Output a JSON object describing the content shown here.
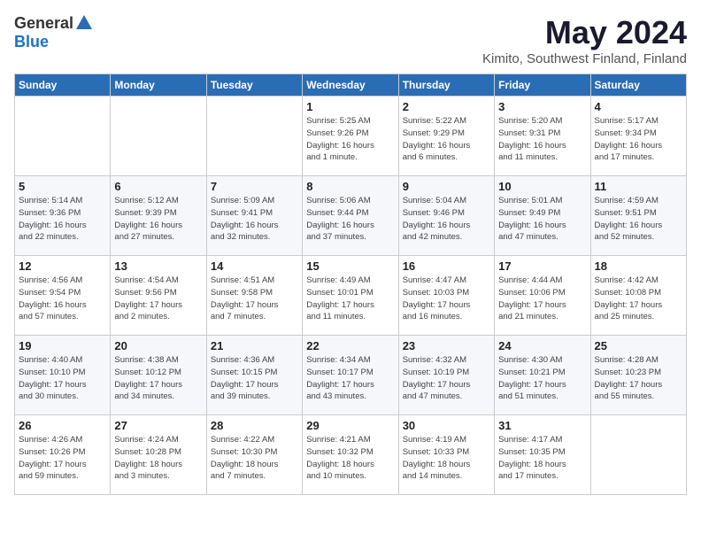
{
  "logo": {
    "general": "General",
    "blue": "Blue"
  },
  "header": {
    "month": "May 2024",
    "location": "Kimito, Southwest Finland, Finland"
  },
  "weekdays": [
    "Sunday",
    "Monday",
    "Tuesday",
    "Wednesday",
    "Thursday",
    "Friday",
    "Saturday"
  ],
  "weeks": [
    [
      {
        "day": "",
        "info": ""
      },
      {
        "day": "",
        "info": ""
      },
      {
        "day": "",
        "info": ""
      },
      {
        "day": "1",
        "info": "Sunrise: 5:25 AM\nSunset: 9:26 PM\nDaylight: 16 hours\nand 1 minute."
      },
      {
        "day": "2",
        "info": "Sunrise: 5:22 AM\nSunset: 9:29 PM\nDaylight: 16 hours\nand 6 minutes."
      },
      {
        "day": "3",
        "info": "Sunrise: 5:20 AM\nSunset: 9:31 PM\nDaylight: 16 hours\nand 11 minutes."
      },
      {
        "day": "4",
        "info": "Sunrise: 5:17 AM\nSunset: 9:34 PM\nDaylight: 16 hours\nand 17 minutes."
      }
    ],
    [
      {
        "day": "5",
        "info": "Sunrise: 5:14 AM\nSunset: 9:36 PM\nDaylight: 16 hours\nand 22 minutes."
      },
      {
        "day": "6",
        "info": "Sunrise: 5:12 AM\nSunset: 9:39 PM\nDaylight: 16 hours\nand 27 minutes."
      },
      {
        "day": "7",
        "info": "Sunrise: 5:09 AM\nSunset: 9:41 PM\nDaylight: 16 hours\nand 32 minutes."
      },
      {
        "day": "8",
        "info": "Sunrise: 5:06 AM\nSunset: 9:44 PM\nDaylight: 16 hours\nand 37 minutes."
      },
      {
        "day": "9",
        "info": "Sunrise: 5:04 AM\nSunset: 9:46 PM\nDaylight: 16 hours\nand 42 minutes."
      },
      {
        "day": "10",
        "info": "Sunrise: 5:01 AM\nSunset: 9:49 PM\nDaylight: 16 hours\nand 47 minutes."
      },
      {
        "day": "11",
        "info": "Sunrise: 4:59 AM\nSunset: 9:51 PM\nDaylight: 16 hours\nand 52 minutes."
      }
    ],
    [
      {
        "day": "12",
        "info": "Sunrise: 4:56 AM\nSunset: 9:54 PM\nDaylight: 16 hours\nand 57 minutes."
      },
      {
        "day": "13",
        "info": "Sunrise: 4:54 AM\nSunset: 9:56 PM\nDaylight: 17 hours\nand 2 minutes."
      },
      {
        "day": "14",
        "info": "Sunrise: 4:51 AM\nSunset: 9:58 PM\nDaylight: 17 hours\nand 7 minutes."
      },
      {
        "day": "15",
        "info": "Sunrise: 4:49 AM\nSunset: 10:01 PM\nDaylight: 17 hours\nand 11 minutes."
      },
      {
        "day": "16",
        "info": "Sunrise: 4:47 AM\nSunset: 10:03 PM\nDaylight: 17 hours\nand 16 minutes."
      },
      {
        "day": "17",
        "info": "Sunrise: 4:44 AM\nSunset: 10:06 PM\nDaylight: 17 hours\nand 21 minutes."
      },
      {
        "day": "18",
        "info": "Sunrise: 4:42 AM\nSunset: 10:08 PM\nDaylight: 17 hours\nand 25 minutes."
      }
    ],
    [
      {
        "day": "19",
        "info": "Sunrise: 4:40 AM\nSunset: 10:10 PM\nDaylight: 17 hours\nand 30 minutes."
      },
      {
        "day": "20",
        "info": "Sunrise: 4:38 AM\nSunset: 10:12 PM\nDaylight: 17 hours\nand 34 minutes."
      },
      {
        "day": "21",
        "info": "Sunrise: 4:36 AM\nSunset: 10:15 PM\nDaylight: 17 hours\nand 39 minutes."
      },
      {
        "day": "22",
        "info": "Sunrise: 4:34 AM\nSunset: 10:17 PM\nDaylight: 17 hours\nand 43 minutes."
      },
      {
        "day": "23",
        "info": "Sunrise: 4:32 AM\nSunset: 10:19 PM\nDaylight: 17 hours\nand 47 minutes."
      },
      {
        "day": "24",
        "info": "Sunrise: 4:30 AM\nSunset: 10:21 PM\nDaylight: 17 hours\nand 51 minutes."
      },
      {
        "day": "25",
        "info": "Sunrise: 4:28 AM\nSunset: 10:23 PM\nDaylight: 17 hours\nand 55 minutes."
      }
    ],
    [
      {
        "day": "26",
        "info": "Sunrise: 4:26 AM\nSunset: 10:26 PM\nDaylight: 17 hours\nand 59 minutes."
      },
      {
        "day": "27",
        "info": "Sunrise: 4:24 AM\nSunset: 10:28 PM\nDaylight: 18 hours\nand 3 minutes."
      },
      {
        "day": "28",
        "info": "Sunrise: 4:22 AM\nSunset: 10:30 PM\nDaylight: 18 hours\nand 7 minutes."
      },
      {
        "day": "29",
        "info": "Sunrise: 4:21 AM\nSunset: 10:32 PM\nDaylight: 18 hours\nand 10 minutes."
      },
      {
        "day": "30",
        "info": "Sunrise: 4:19 AM\nSunset: 10:33 PM\nDaylight: 18 hours\nand 14 minutes."
      },
      {
        "day": "31",
        "info": "Sunrise: 4:17 AM\nSunset: 10:35 PM\nDaylight: 18 hours\nand 17 minutes."
      },
      {
        "day": "",
        "info": ""
      }
    ]
  ]
}
